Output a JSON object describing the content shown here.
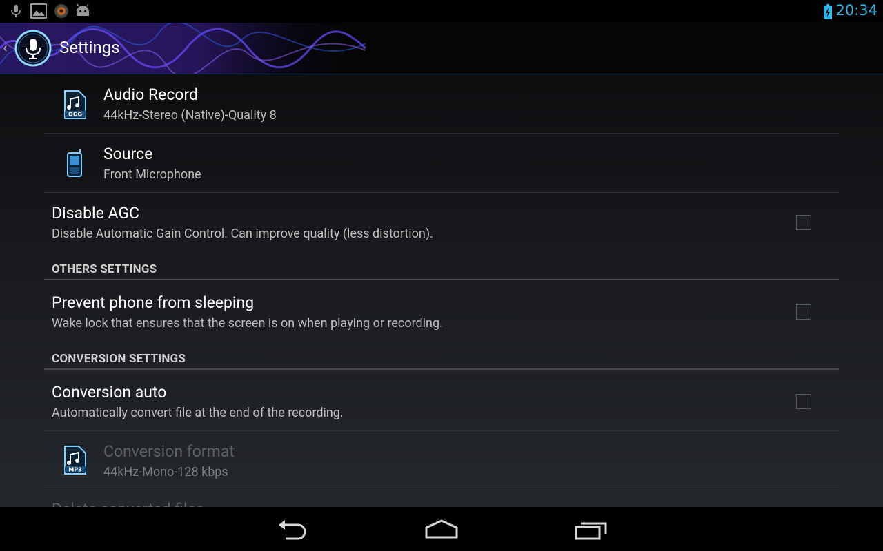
{
  "status_bar": {
    "time": "20:34",
    "notification_icons": [
      "microphone-icon",
      "image-icon",
      "record-app-icon",
      "android-icon"
    ],
    "battery_icon": "battery-charging-icon",
    "time_color": "#33b5e5"
  },
  "action_bar": {
    "title": "Settings",
    "app_icon": "microphone-icon"
  },
  "preferences": {
    "audio_record": {
      "title": "Audio Record",
      "summary": "44kHz-Stereo (Native)-Quality 8",
      "icon": "ogg-file-icon",
      "icon_label": "OGG"
    },
    "source": {
      "title": "Source",
      "summary": "Front Microphone",
      "icon": "phone-icon"
    },
    "disable_agc": {
      "title": "Disable AGC",
      "summary": "Disable Automatic Gain Control. Can improve quality (less distortion).",
      "checked": false
    },
    "others_section": "OTHERS SETTINGS",
    "prevent_sleep": {
      "title": "Prevent phone from sleeping",
      "summary": "Wake lock that ensures that the screen is on when playing or recording.",
      "checked": false
    },
    "conversion_section": "CONVERSION SETTINGS",
    "conversion_auto": {
      "title": "Conversion auto",
      "summary": "Automatically convert file at the end of the recording.",
      "checked": false
    },
    "conversion_format": {
      "title": "Conversion format",
      "summary": "44kHz-Mono-128 kbps",
      "icon": "mp3-file-icon",
      "icon_label": "MP3",
      "enabled": false
    },
    "delete_converted": {
      "title": "Delete converted files"
    }
  },
  "nav_bar": {
    "buttons": [
      "back-icon",
      "home-icon",
      "recent-apps-icon"
    ]
  }
}
